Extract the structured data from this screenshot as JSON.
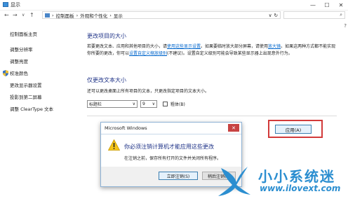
{
  "window": {
    "title": "显示",
    "buttons": {
      "minimize": "—",
      "maximize": "☐",
      "close": "✕"
    }
  },
  "address": {
    "back": "←",
    "forward": "→",
    "recent": "∨",
    "up": "↑",
    "sep": "›",
    "crumbs": [
      "控制面板",
      "外观和个性化",
      "显示"
    ],
    "dropdown": "∨",
    "refresh": "↻",
    "search_glyph": "⌕"
  },
  "sidebar": {
    "items": [
      {
        "label": "控制面板主页"
      },
      {
        "label": "调整分辨率"
      },
      {
        "label": "调整亮度"
      },
      {
        "label": "校准颜色"
      },
      {
        "label": "更改显示器设置"
      },
      {
        "label": "投影到第二屏幕"
      },
      {
        "label": "调整 ClearType 文本"
      }
    ]
  },
  "main": {
    "heading1": "更改项目的大小",
    "para1_a": "若要更改文本、应用和其他项目的大小，请",
    "para1_link1": "使用这些显示设置",
    "para1_b": "。如果要临时放大部分屏幕，请使用",
    "para1_link2": "放大镜",
    "para1_c": "。如果这两种方式都不能实现你所要的更改，你可以",
    "para1_link3": "设置自定义缩放级别",
    "para1_d": "(不建议)。设置自定义级别可能会导致某些显示器上出现意外行为。",
    "heading2": "仅更改文本大小",
    "para2": "还可以更改桌面上所有项目的文本，只更改指定项目的文本大小。",
    "dropdown_item": "标题栏",
    "dropdown_size": "9",
    "dropdown_arrow": "∨",
    "bold_label": "粗体(B)",
    "apply_label": "应用(A)"
  },
  "dialog": {
    "title": "Microsoft Windows",
    "close": "✕",
    "message": "你必须注销计算机才能应用这些更改",
    "sub": "在注销之前，保存所有打开的文件并关闭所有程序。",
    "btn_logout": "立即注销(S)",
    "btn_later": "稍后注销(L)"
  },
  "watermark": {
    "name": "小小系统迷",
    "url": "www.ilovext.com"
  },
  "scroll": {
    "up": "?"
  },
  "colors": {
    "link": "#0066cc",
    "heading": "#1e3287",
    "highlight": "#d23a3a",
    "watermark": "#2b8ed0"
  }
}
